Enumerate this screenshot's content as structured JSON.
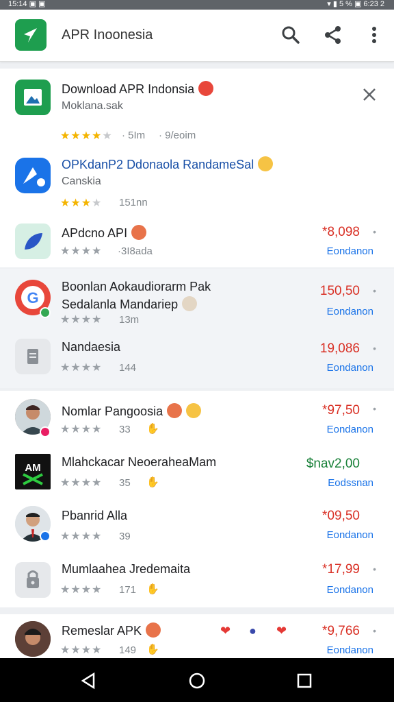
{
  "status": {
    "left": "15:14  ▣  ▣",
    "right": "▾ ▮ 5 % ▣  6:23 2"
  },
  "appbar": {
    "title": "APR Inoonesia",
    "logo_icon": "compass-arrow-icon"
  },
  "card1": {
    "row1": {
      "name": "Download APR Indonsia",
      "sub": "Moklana.sak",
      "rating": 4,
      "size": "· 5Im",
      "downloads": "· 9/eoim"
    },
    "row2": {
      "name": "OPKdanP2 Ddonaola RandameSal",
      "sub": "Canskia",
      "rating": 3,
      "size": "151nn"
    },
    "row3": {
      "name": "APdcno API",
      "meta": "·3I8ada",
      "price": "*8,098",
      "action": "Eondanon"
    }
  },
  "card2": {
    "row1": {
      "name": "Boonlan Aokaudiorarm Pak",
      "sub": "Sedalanla Mandariep",
      "meta": "13m",
      "price": "150,50",
      "action": "Eondanon"
    },
    "row2": {
      "name": "Nandaesia",
      "meta": "144",
      "price": "19,086",
      "action": "Eondanon"
    }
  },
  "card3": {
    "row1": {
      "name": "Nomlar Pangoosia",
      "meta": "33",
      "price": "*97,50",
      "action": "Eondanon"
    },
    "row2": {
      "name": "Mlahckacar NeoeraheaMam",
      "meta": "35",
      "price": "$nav2,00",
      "action": "Eodssnan"
    },
    "row3": {
      "name": "Pbanrid Alla",
      "meta": "39",
      "price": "*09,50",
      "action": "Eondanon"
    },
    "row4": {
      "name": "Mumlaahea Jredemaita",
      "meta": "171",
      "price": "*17,99",
      "action": "Eondanon"
    }
  },
  "card4": {
    "row1": {
      "name": "Remeslar APK",
      "meta": "149",
      "price": "*9,766",
      "action": "Eondanon"
    }
  },
  "colors": {
    "accent": "#1a73e8",
    "price": "#d93025",
    "star": "#f4b400"
  }
}
